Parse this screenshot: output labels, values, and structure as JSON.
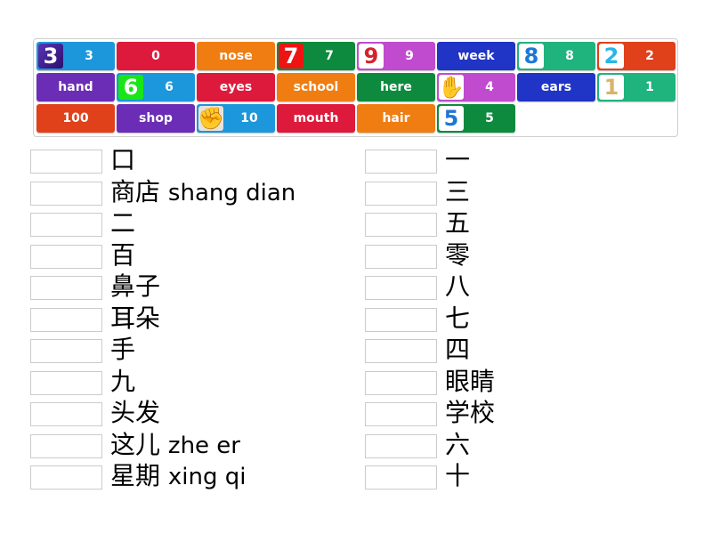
{
  "tiles": [
    {
      "label": "3",
      "color": "#1c97db",
      "image": {
        "icon": "digit-3-image",
        "glyph": "3",
        "cls": "img-3"
      }
    },
    {
      "label": "0",
      "color": "#dd1a3b"
    },
    {
      "label": "nose",
      "color": "#f07d12"
    },
    {
      "label": "7",
      "color": "#0d8a3e",
      "image": {
        "icon": "digit-7-image",
        "glyph": "7",
        "cls": "img-7"
      }
    },
    {
      "label": "9",
      "color": "#c04bcf",
      "image": {
        "icon": "digit-9-image",
        "glyph": "9",
        "cls": "img-9"
      }
    },
    {
      "label": "week",
      "color": "#2034c5"
    },
    {
      "label": "8",
      "color": "#1fb37e",
      "image": {
        "icon": "digit-8-image",
        "glyph": "8",
        "cls": "img-8"
      }
    },
    {
      "label": "2",
      "color": "#e0401a",
      "image": {
        "icon": "digit-2-image",
        "glyph": "2",
        "cls": "img-2"
      }
    },
    {
      "label": "hand",
      "color": "#6b2db5"
    },
    {
      "label": "6",
      "color": "#1c97db",
      "image": {
        "icon": "digit-6-image",
        "glyph": "6",
        "cls": "img-6"
      }
    },
    {
      "label": "eyes",
      "color": "#dd1a3b"
    },
    {
      "label": "school",
      "color": "#f07d12"
    },
    {
      "label": "here",
      "color": "#0d8a3e"
    },
    {
      "label": "4",
      "color": "#c04bcf",
      "image": {
        "icon": "four-fingers-hand-image",
        "glyph": "✋",
        "cls": "img-hand4"
      }
    },
    {
      "label": "ears",
      "color": "#2034c5"
    },
    {
      "label": "1",
      "color": "#1fb37e",
      "image": {
        "icon": "digit-1-image",
        "glyph": "1",
        "cls": "img-1"
      }
    },
    {
      "label": "100",
      "color": "#e0401a"
    },
    {
      "label": "shop",
      "color": "#6b2db5"
    },
    {
      "label": "10",
      "color": "#1c97db",
      "image": {
        "icon": "fist-image",
        "glyph": "✊",
        "cls": "img-fist"
      }
    },
    {
      "label": "mouth",
      "color": "#dd1a3b"
    },
    {
      "label": "hair",
      "color": "#f07d12"
    },
    {
      "label": "5",
      "color": "#0d8a3e",
      "image": {
        "icon": "digit-5-image",
        "glyph": "5",
        "cls": "img-5"
      }
    }
  ],
  "left_targets": [
    {
      "hanzi": "口",
      "pinyin": ""
    },
    {
      "hanzi": "商店",
      "pinyin": "shang dian"
    },
    {
      "hanzi": "二",
      "pinyin": ""
    },
    {
      "hanzi": "百",
      "pinyin": ""
    },
    {
      "hanzi": "鼻子",
      "pinyin": ""
    },
    {
      "hanzi": "耳朵",
      "pinyin": ""
    },
    {
      "hanzi": "手",
      "pinyin": ""
    },
    {
      "hanzi": "九",
      "pinyin": ""
    },
    {
      "hanzi": "头发",
      "pinyin": ""
    },
    {
      "hanzi": "这儿",
      "pinyin": "zhe er"
    },
    {
      "hanzi": "星期",
      "pinyin": "xing qi"
    }
  ],
  "right_targets": [
    {
      "hanzi": "一",
      "pinyin": ""
    },
    {
      "hanzi": "三",
      "pinyin": ""
    },
    {
      "hanzi": "五",
      "pinyin": ""
    },
    {
      "hanzi": "零",
      "pinyin": ""
    },
    {
      "hanzi": "八",
      "pinyin": ""
    },
    {
      "hanzi": "七",
      "pinyin": ""
    },
    {
      "hanzi": "四",
      "pinyin": ""
    },
    {
      "hanzi": "眼睛",
      "pinyin": ""
    },
    {
      "hanzi": "学校",
      "pinyin": ""
    },
    {
      "hanzi": "六",
      "pinyin": ""
    },
    {
      "hanzi": "十",
      "pinyin": ""
    }
  ]
}
